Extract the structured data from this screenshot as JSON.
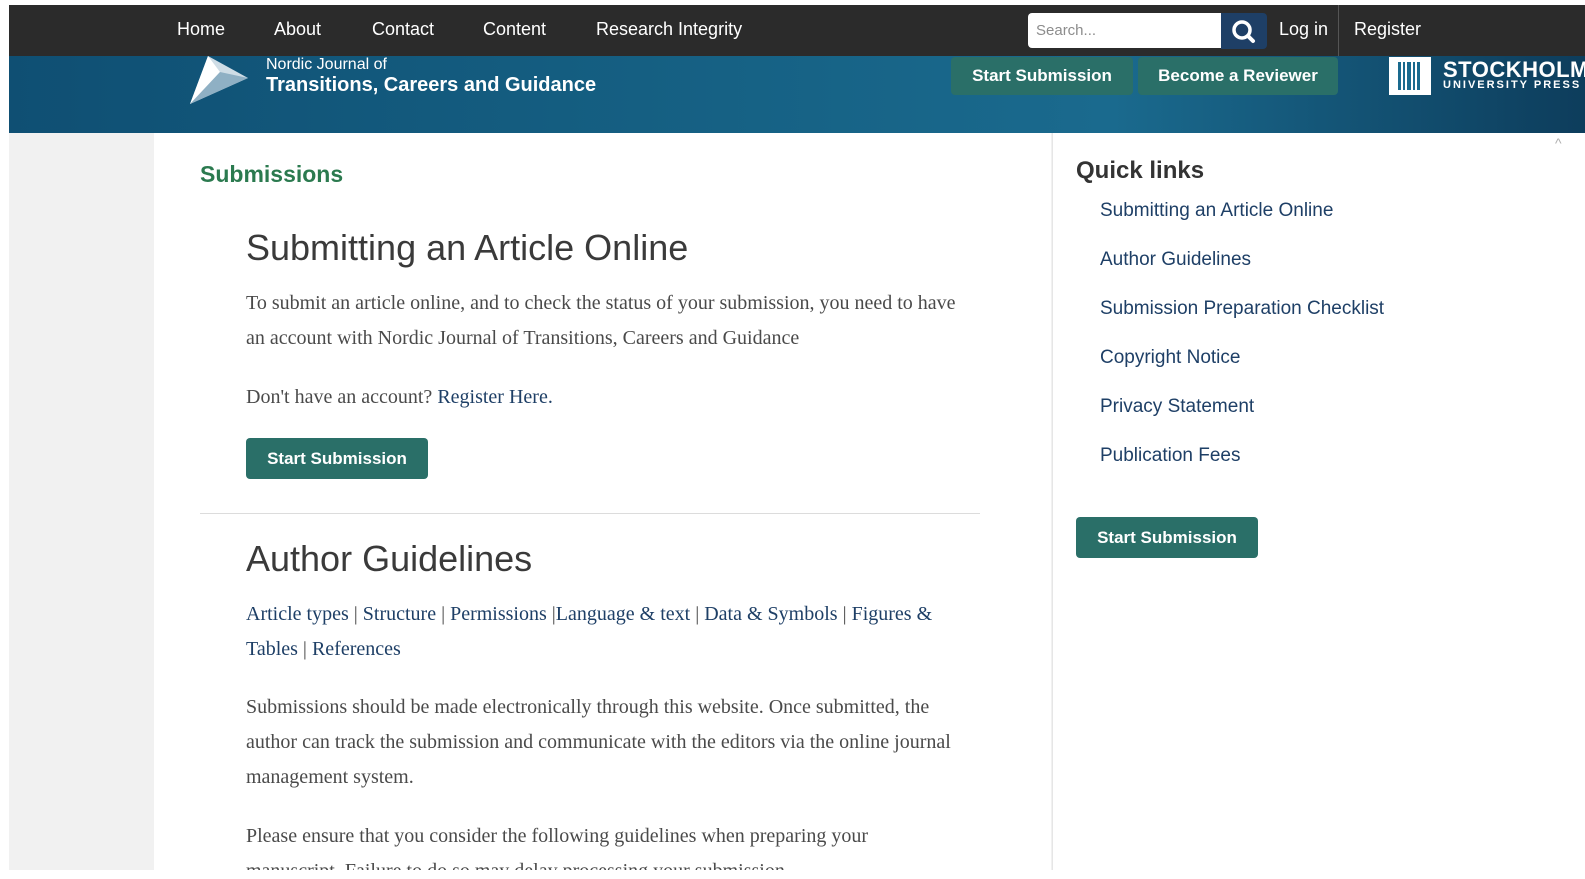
{
  "nav": {
    "items": [
      "Home",
      "About",
      "Contact",
      "Content",
      "Research Integrity"
    ],
    "search_placeholder": "Search...",
    "login": "Log in",
    "register": "Register"
  },
  "header": {
    "journal_line1": "Nordic Journal of",
    "journal_line2": "Transitions, Careers and Guidance",
    "start_submission": "Start Submission",
    "become_reviewer": "Become a Reviewer",
    "publisher_line1": "STOCKHOLM",
    "publisher_line2": "UNIVERSITY PRESS"
  },
  "main": {
    "page_title": "Submissions",
    "section1": {
      "heading": "Submitting an Article Online",
      "para": "To submit an article online, and to check the status of your submission, you need to have an account with Nordic Journal of Transitions, Careers and Guidance",
      "no_account": "Don't have an account?",
      "register_link": "Register Here.",
      "button": "Start Submission"
    },
    "section2": {
      "heading": "Author Guidelines",
      "links": [
        "Article types",
        "Structure",
        "Permissions",
        "Language & text",
        "Data & Symbols",
        "Figures & Tables",
        "References"
      ],
      "para1": "Submissions should be made electronically through this website. Once submitted, the author can track the submission and communicate with the editors via the online journal management system.",
      "para2": "Please ensure that you consider the following guidelines when preparing your manuscript. Failure to do so may delay processing your submission."
    }
  },
  "sidebar": {
    "title": "Quick links",
    "items": [
      "Submitting an Article Online",
      "Author Guidelines",
      "Submission Preparation Checklist",
      "Copyright Notice",
      "Privacy Statement",
      "Publication Fees"
    ],
    "button": "Start Submission"
  },
  "colors": {
    "nav_bg": "#2b2b2b",
    "banner": "#155f82",
    "button_green": "#2a6f68",
    "title_green": "#2b7a4f",
    "link_blue": "#1e3f66"
  }
}
